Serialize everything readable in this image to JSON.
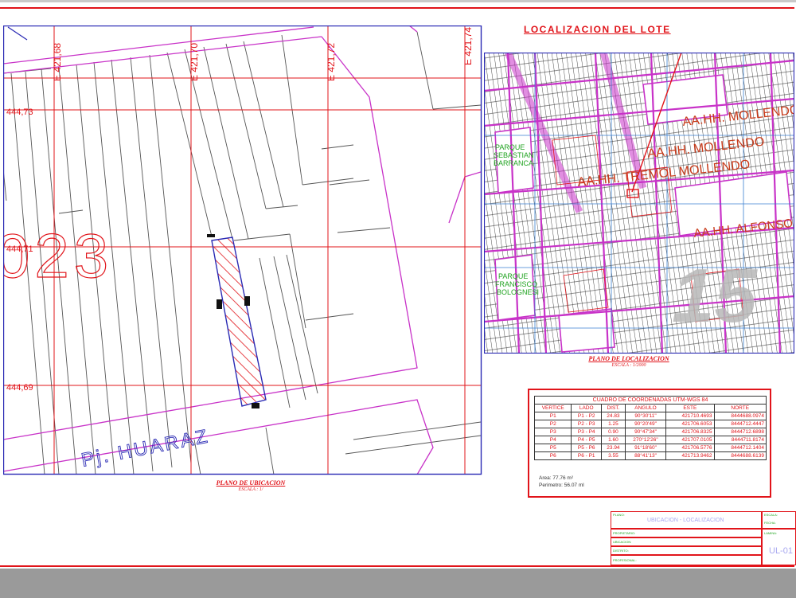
{
  "location_map": {
    "title": "LOCALIZACION DEL LOTE",
    "caption_title": "PLANO DE LOCALIZACION",
    "caption_scale": "ESCALA : 1/2000",
    "district_labels": [
      "AA.HH. MOLLENDO",
      "AA.HH. MOLLENDO",
      "AA.HH. TREMOL MOLLENDO",
      "AA.HH. ALFONSO"
    ],
    "park_labels": [
      "PARQUE SEBASTIAN BARRANCA",
      "PARQUE FRANCISCO BOLOGNESI"
    ],
    "sector_number": "15"
  },
  "site_plan": {
    "easting_labels": [
      "E 421,68",
      "E 421,70",
      "E 421,72",
      "E 421,74"
    ],
    "northing_labels": [
      "444,73",
      "444,71",
      "444,69"
    ],
    "block_number": "023",
    "street_label": "Pj. HUARAZ",
    "caption_title": "PLANO DE UBICACION",
    "caption_scale": "ESCALA : 1/"
  },
  "coordinates_table": {
    "title": "CUADRO DE COORDENADAS UTM-WGS 84",
    "headers": [
      "VERTICE",
      "LADO",
      "DIST.",
      "ANGULO",
      "ESTE",
      "NORTE"
    ],
    "rows": [
      [
        "P1",
        "P1 - P2",
        "24.83",
        "90°30'11\"",
        "421710.4693",
        "8444688.0974"
      ],
      [
        "P2",
        "P2 - P3",
        "1.25",
        "90°20'49\"",
        "421706.6053",
        "8444712.4447"
      ],
      [
        "P3",
        "P3 - P4",
        "0.90",
        "90°47'34\"",
        "421706.8325",
        "8444712.6898"
      ],
      [
        "P4",
        "P4 - P5",
        "1.60",
        "270°12'26\"",
        "421707.0105",
        "8444711.8174"
      ],
      [
        "P5",
        "P5 - P6",
        "23.94",
        "91°18'60\"",
        "421706.5776",
        "8444712.1404"
      ],
      [
        "P6",
        "P6 - P1",
        "3.55",
        "88°41'13\"",
        "421713.9462",
        "8444688.6139"
      ]
    ],
    "area": "Area: 77.76 m²",
    "perimeter": "Perimetro: 56.07 ml"
  },
  "title_block": {
    "label_plano": "PLANO:",
    "plan_name": "UBICACION - LOCALIZACION",
    "label_propietario": "PROPIETARIO:",
    "label_ubicacion": "UBICACION:",
    "label_distrito": "DISTRITO:",
    "label_profesional": "PROFESIONAL:",
    "label_lamina": "LAMINA:",
    "label_escala": "ESCALA:",
    "label_fecha": "FECHA:",
    "sheet_code": "UL-01"
  },
  "colors": {
    "red": "#e1141a",
    "magenta": "#c832c8",
    "blue": "#2a2ab4",
    "gray_bar": "#9a9a9a",
    "green": "#1fa31f"
  }
}
